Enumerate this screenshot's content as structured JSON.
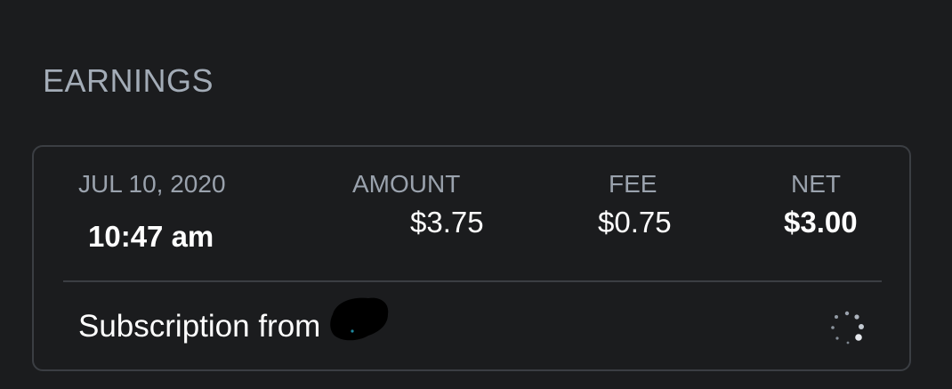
{
  "section": {
    "title": "EARNINGS"
  },
  "transaction": {
    "date": "JUL 10, 2020",
    "time": "10:47 am",
    "amount_label": "AMOUNT",
    "amount": "$3.75",
    "fee_label": "FEE",
    "fee": "$0.75",
    "net_label": "NET",
    "net": "$3.00",
    "description": "Subscription from"
  },
  "icons": {
    "status": "loading-spinner-icon"
  },
  "colors": {
    "background": "#1b1c1e",
    "section_title": "#a3acb7",
    "card_border": "#3b3e43",
    "muted_label": "#9aa2ad",
    "value_text": "#ffffff"
  }
}
